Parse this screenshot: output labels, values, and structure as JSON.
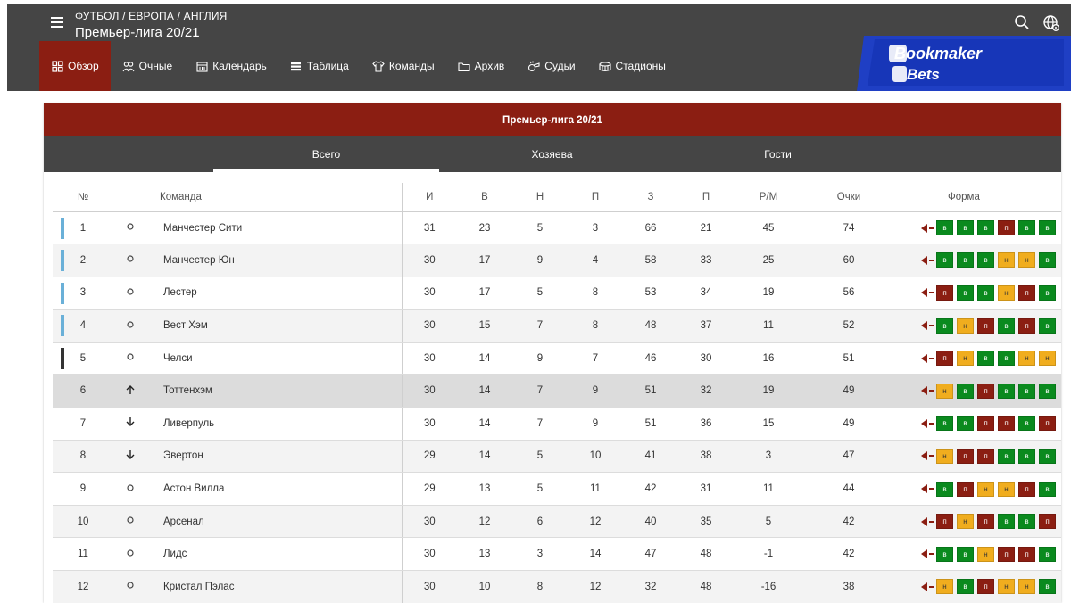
{
  "header": {
    "breadcrumb": "ФУТБОЛ / ЕВРОПА / АНГЛИЯ",
    "title": "Премьер-лига 20/21"
  },
  "nav": [
    {
      "label": "Обзор",
      "icon": "grid-icon",
      "active": true
    },
    {
      "label": "Очные",
      "icon": "users-icon",
      "active": false
    },
    {
      "label": "Календарь",
      "icon": "calendar-icon",
      "active": false
    },
    {
      "label": "Таблица",
      "icon": "table-icon",
      "active": false
    },
    {
      "label": "Команды",
      "icon": "shirt-icon",
      "active": false
    },
    {
      "label": "Архив",
      "icon": "folder-icon",
      "active": false
    },
    {
      "label": "Судьи",
      "icon": "whistle-icon",
      "active": false
    },
    {
      "label": "Стадионы",
      "icon": "stadium-icon",
      "active": false
    }
  ],
  "logo": {
    "line1": "Bookmaker",
    "line2": "Bets"
  },
  "panel": {
    "title": "Премьер-лига 20/21",
    "tabs": [
      "Всего",
      "Хозяева",
      "Гости"
    ]
  },
  "columns": {
    "pos": "№",
    "team": "Команда",
    "played": "И",
    "won": "В",
    "drawn": "Н",
    "lost": "П",
    "gf": "З",
    "ga": "П",
    "gd": "Р/М",
    "pts": "Очки",
    "form": "Форма"
  },
  "colors": {
    "accent": "#8b1e12",
    "dark": "#454545",
    "win": "#0a8a1e",
    "draw": "#f0ad1e",
    "loss": "#8b1e12",
    "cl_bar": "#6ab0d8",
    "el_bar": "#333333"
  },
  "rows": [
    {
      "pos": "1",
      "move": "same",
      "team": "Манчестер Сити",
      "played": "31",
      "won": "23",
      "drawn": "5",
      "lost": "3",
      "gf": "66",
      "ga": "21",
      "gd": "45",
      "pts": "74",
      "form": [
        "в",
        "в",
        "в",
        "п",
        "в",
        "в"
      ],
      "bar": "cl"
    },
    {
      "pos": "2",
      "move": "same",
      "team": "Манчестер Юн",
      "played": "30",
      "won": "17",
      "drawn": "9",
      "lost": "4",
      "gf": "58",
      "ga": "33",
      "gd": "25",
      "pts": "60",
      "form": [
        "в",
        "в",
        "в",
        "н",
        "н",
        "в"
      ],
      "bar": "cl"
    },
    {
      "pos": "3",
      "move": "same",
      "team": "Лестер",
      "played": "30",
      "won": "17",
      "drawn": "5",
      "lost": "8",
      "gf": "53",
      "ga": "34",
      "gd": "19",
      "pts": "56",
      "form": [
        "п",
        "в",
        "в",
        "н",
        "п",
        "в"
      ],
      "bar": "cl"
    },
    {
      "pos": "4",
      "move": "same",
      "team": "Вест Хэм",
      "played": "30",
      "won": "15",
      "drawn": "7",
      "lost": "8",
      "gf": "48",
      "ga": "37",
      "gd": "11",
      "pts": "52",
      "form": [
        "в",
        "н",
        "п",
        "в",
        "п",
        "в"
      ],
      "bar": "cl"
    },
    {
      "pos": "5",
      "move": "same",
      "team": "Челси",
      "played": "30",
      "won": "14",
      "drawn": "9",
      "lost": "7",
      "gf": "46",
      "ga": "30",
      "gd": "16",
      "pts": "51",
      "form": [
        "п",
        "н",
        "в",
        "в",
        "н",
        "н"
      ],
      "bar": "el"
    },
    {
      "pos": "6",
      "move": "up",
      "team": "Тоттенхэм",
      "played": "30",
      "won": "14",
      "drawn": "7",
      "lost": "9",
      "gf": "51",
      "ga": "32",
      "gd": "19",
      "pts": "49",
      "form": [
        "н",
        "в",
        "п",
        "в",
        "в",
        "в"
      ],
      "bar": ""
    },
    {
      "pos": "7",
      "move": "down",
      "team": "Ливерпуль",
      "played": "30",
      "won": "14",
      "drawn": "7",
      "lost": "9",
      "gf": "51",
      "ga": "36",
      "gd": "15",
      "pts": "49",
      "form": [
        "в",
        "в",
        "п",
        "п",
        "в",
        "п"
      ],
      "bar": ""
    },
    {
      "pos": "8",
      "move": "down",
      "team": "Эвертон",
      "played": "29",
      "won": "14",
      "drawn": "5",
      "lost": "10",
      "gf": "41",
      "ga": "38",
      "gd": "3",
      "pts": "47",
      "form": [
        "н",
        "п",
        "п",
        "в",
        "в",
        "в"
      ],
      "bar": ""
    },
    {
      "pos": "9",
      "move": "same",
      "team": "Астон Вилла",
      "played": "29",
      "won": "13",
      "drawn": "5",
      "lost": "11",
      "gf": "42",
      "ga": "31",
      "gd": "11",
      "pts": "44",
      "form": [
        "в",
        "п",
        "н",
        "н",
        "п",
        "в"
      ],
      "bar": ""
    },
    {
      "pos": "10",
      "move": "same",
      "team": "Арсенал",
      "played": "30",
      "won": "12",
      "drawn": "6",
      "lost": "12",
      "gf": "40",
      "ga": "35",
      "gd": "5",
      "pts": "42",
      "form": [
        "п",
        "н",
        "п",
        "в",
        "в",
        "п"
      ],
      "bar": ""
    },
    {
      "pos": "11",
      "move": "same",
      "team": "Лидс",
      "played": "30",
      "won": "13",
      "drawn": "3",
      "lost": "14",
      "gf": "47",
      "ga": "48",
      "gd": "-1",
      "pts": "42",
      "form": [
        "в",
        "в",
        "н",
        "п",
        "п",
        "в"
      ],
      "bar": ""
    },
    {
      "pos": "12",
      "move": "same",
      "team": "Кристал Пэлас",
      "played": "30",
      "won": "10",
      "drawn": "8",
      "lost": "12",
      "gf": "32",
      "ga": "48",
      "gd": "-16",
      "pts": "38",
      "form": [
        "н",
        "в",
        "п",
        "н",
        "н",
        "в"
      ],
      "bar": ""
    }
  ]
}
